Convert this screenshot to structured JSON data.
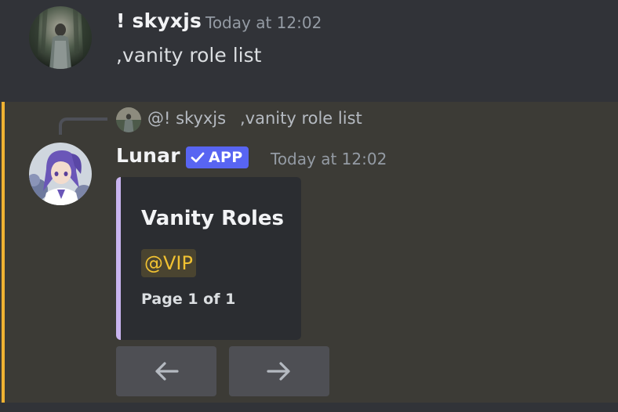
{
  "message_1": {
    "author": "! skyxjs",
    "timestamp": "Today at 12:02",
    "content": ",vanity role list",
    "avatar_icon": "dark-forest-figure-avatar"
  },
  "message_2": {
    "reply": {
      "author": "@! skyxjs",
      "content": ",vanity role list"
    },
    "author": "Lunar",
    "badge": "APP",
    "timestamp": "Today at 12:02",
    "avatar_icon": "purple-hair-anime-avatar",
    "embed": {
      "title": "Vanity Roles",
      "role": "@VIP",
      "footer": "Page 1 of 1",
      "accent_color": "#c9b4ef"
    },
    "buttons": [
      {
        "icon": "arrow-left-icon"
      },
      {
        "icon": "arrow-right-icon"
      }
    ]
  },
  "colors": {
    "background": "#313338",
    "highlight_background": "#3c3b36",
    "mention_bar": "#f0b232",
    "badge": "#5865f2",
    "role_mention_text": "#f1c232",
    "button": "#4e4f54"
  }
}
